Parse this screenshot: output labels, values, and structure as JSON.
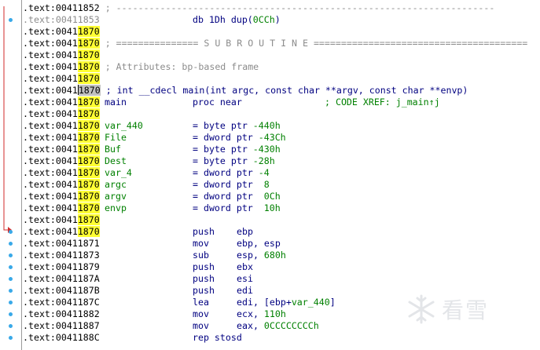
{
  "gutter": {
    "breakpoint_color": "#39a9e8",
    "arrow_color": "#d22b2b"
  },
  "rows": [
    {
      "sec": ".text:",
      "pre": "00411852",
      "hl": "",
      "post": "",
      "addr_style": "black",
      "c0": " ; ---------------------------------------------------------------------",
      "c0_class": "comment"
    },
    {
      "sec": ".text:",
      "pre": "00411853",
      "hl": "",
      "post": "",
      "addr_style": "gray",
      "c2": "db 1Dh dup(",
      "c2b": "0CCh",
      "c2c": ")"
    },
    {
      "sec": ".text:",
      "pre": "0041",
      "hl": "1870",
      "post": "",
      "addr_style": "black"
    },
    {
      "sec": ".text:",
      "pre": "0041",
      "hl": "1870",
      "post": "",
      "addr_style": "black",
      "c0": " ; =============== S U B R O U T I N E =======================================",
      "c0_class": "comment"
    },
    {
      "sec": ".text:",
      "pre": "0041",
      "hl": "1870",
      "post": "",
      "addr_style": "black"
    },
    {
      "sec": ".text:",
      "pre": "0041",
      "hl": "1870",
      "post": "",
      "addr_style": "black",
      "c0": " ; Attributes: bp-based frame",
      "c0_class": "comment"
    },
    {
      "sec": ".text:",
      "pre": "0041",
      "hl": "1870",
      "post": "",
      "addr_style": "black"
    },
    {
      "sec": ".text:",
      "pre": "0041",
      "hl": "1870",
      "post": "",
      "addr_style": "black",
      "cursor": true,
      "c0": " ; int __cdecl main(int argc, const char **argv, const char **envp)",
      "c0_class": "name"
    },
    {
      "sec": ".text:",
      "pre": "0041",
      "hl": "1870",
      "post": "",
      "addr_style": "black",
      "c1": "main",
      "c2": "proc near",
      "c4": "; CODE XREF: j_main↑j",
      "c4_class": "xref"
    },
    {
      "sec": ".text:",
      "pre": "0041",
      "hl": "1870",
      "post": "",
      "addr_style": "black"
    },
    {
      "sec": ".text:",
      "pre": "0041",
      "hl": "1870",
      "post": "",
      "addr_style": "black",
      "c1": "var_440",
      "c1_class": "lbl",
      "c2": "= byte ptr ",
      "c2b": "-440h"
    },
    {
      "sec": ".text:",
      "pre": "0041",
      "hl": "1870",
      "post": "",
      "addr_style": "black",
      "c1": "File",
      "c1_class": "lbl",
      "c2": "= dword ptr ",
      "c2b": "-43Ch"
    },
    {
      "sec": ".text:",
      "pre": "0041",
      "hl": "1870",
      "post": "",
      "addr_style": "black",
      "c1": "Buf",
      "c1_class": "lbl",
      "c2": "= byte ptr ",
      "c2b": "-430h"
    },
    {
      "sec": ".text:",
      "pre": "0041",
      "hl": "1870",
      "post": "",
      "addr_style": "black",
      "c1": "Dest",
      "c1_class": "lbl",
      "c2": "= byte ptr ",
      "c2b": "-28h"
    },
    {
      "sec": ".text:",
      "pre": "0041",
      "hl": "1870",
      "post": "",
      "addr_style": "black",
      "c1": "var_4",
      "c1_class": "lbl",
      "c2": "= dword ptr ",
      "c2b": "-4"
    },
    {
      "sec": ".text:",
      "pre": "0041",
      "hl": "1870",
      "post": "",
      "addr_style": "black",
      "c1": "argc",
      "c1_class": "lbl",
      "c2": "= dword ptr  ",
      "c2b": "8"
    },
    {
      "sec": ".text:",
      "pre": "0041",
      "hl": "1870",
      "post": "",
      "addr_style": "black",
      "c1": "argv",
      "c1_class": "lbl",
      "c2": "= dword ptr  ",
      "c2b": "0Ch"
    },
    {
      "sec": ".text:",
      "pre": "0041",
      "hl": "1870",
      "post": "",
      "addr_style": "black",
      "c1": "envp",
      "c1_class": "lbl",
      "c2": "= dword ptr  ",
      "c2b": "10h"
    },
    {
      "sec": ".text:",
      "pre": "0041",
      "hl": "1870",
      "post": "",
      "addr_style": "black"
    },
    {
      "sec": ".text:",
      "pre": "0041",
      "hl": "1870",
      "post": "",
      "addr_style": "black",
      "c2": "push",
      "c3": "ebp"
    },
    {
      "sec": ".text:",
      "pre": "00411871",
      "hl": "",
      "post": "",
      "addr_style": "black",
      "c2": "mov",
      "c3": "ebp, esp"
    },
    {
      "sec": ".text:",
      "pre": "00411873",
      "hl": "",
      "post": "",
      "addr_style": "black",
      "c2": "sub",
      "c3": "esp, ",
      "c3b": "680h"
    },
    {
      "sec": ".text:",
      "pre": "00411879",
      "hl": "",
      "post": "",
      "addr_style": "black",
      "c2": "push",
      "c3": "ebx"
    },
    {
      "sec": ".text:",
      "pre": "0041187A",
      "hl": "",
      "post": "",
      "addr_style": "black",
      "c2": "push",
      "c3": "esi"
    },
    {
      "sec": ".text:",
      "pre": "0041187B",
      "hl": "",
      "post": "",
      "addr_style": "black",
      "c2": "push",
      "c3": "edi"
    },
    {
      "sec": ".text:",
      "pre": "0041187C",
      "hl": "",
      "post": "",
      "addr_style": "black",
      "c2": "lea",
      "c3": "edi, [ebp+",
      "c3b": "var_440",
      "c3c": "]"
    },
    {
      "sec": ".text:",
      "pre": "00411882",
      "hl": "",
      "post": "",
      "addr_style": "black",
      "c2": "mov",
      "c3": "ecx, ",
      "c3b": "110h"
    },
    {
      "sec": ".text:",
      "pre": "00411887",
      "hl": "",
      "post": "",
      "addr_style": "black",
      "c2": "mov",
      "c3": "eax, ",
      "c3b": "0CCCCCCCCh"
    },
    {
      "sec": ".text:",
      "pre": "0041188C",
      "hl": "",
      "post": "",
      "addr_style": "black",
      "c2": "rep stosd"
    }
  ],
  "breakpoint_rows": [
    1,
    19,
    20,
    21,
    22,
    23,
    24,
    25,
    26,
    27,
    28
  ],
  "watermark": {
    "text": "看雪",
    "icon": "snowflake-icon"
  }
}
